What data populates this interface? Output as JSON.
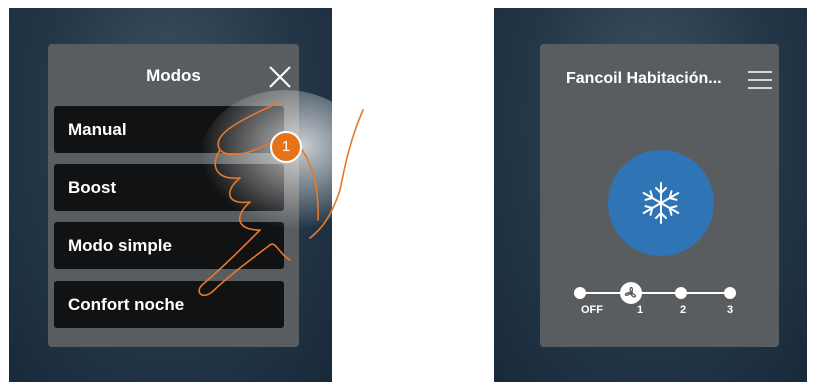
{
  "modes_panel": {
    "title": "Modos",
    "options": [
      "Manual",
      "Boost",
      "Modo simple",
      "Confort noche"
    ]
  },
  "instruction": {
    "step_number": "1"
  },
  "fancoil_panel": {
    "title": "Fancoil Habitación...",
    "mode_icon": "snowflake-icon",
    "speed_levels": [
      "OFF",
      "1",
      "2",
      "3"
    ],
    "selected_speed": "1"
  },
  "colors": {
    "panel_bg": "#5a5d60",
    "button_bg": "#101214",
    "accent_blue": "#2f75b6",
    "step_orange": "#e67318"
  }
}
